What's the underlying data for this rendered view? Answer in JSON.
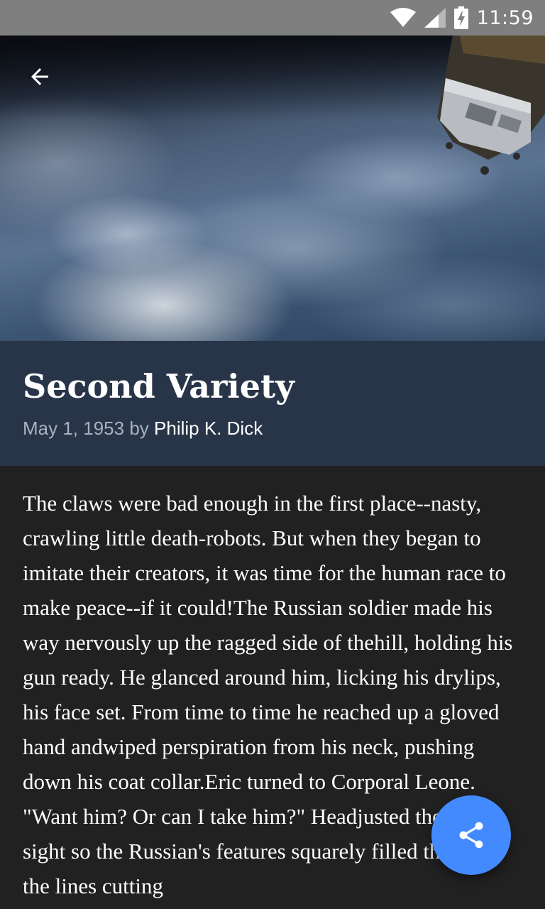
{
  "status_bar": {
    "time": "11:59",
    "icons": [
      "wifi-icon",
      "signal-icon",
      "battery-charging-icon"
    ]
  },
  "toolbar": {
    "back_icon": "arrow-back-icon"
  },
  "hero": {
    "image_subject": "Earth from orbit with a space station"
  },
  "article": {
    "title": "Second Variety",
    "date": "May 1, 1953",
    "by": "by",
    "author": "Philip K. Dick",
    "body": "The claws were bad enough in the first place--nasty, crawling little death-robots. But when they began to imitate their creators, it was time for the human race to make peace--if it could!The Russian soldier made his way nervously up the ragged side of thehill, holding his gun ready. He glanced around him, licking his drylips, his face set. From time to time he reached up a gloved hand andwiped perspiration from his neck, pushing down his coat collar.Eric turned to Corporal Leone. \"Want him? Or can I take him?\" Headjusted the view sight so the Russian's features squarely filled theglass, the lines cutting"
  },
  "fab": {
    "icon": "share-icon",
    "color": "#448aff"
  },
  "colors": {
    "status_bar": "#7f7f7f",
    "title_block": "#283548",
    "background": "#212121",
    "byline_date": "#a9b1bd"
  }
}
